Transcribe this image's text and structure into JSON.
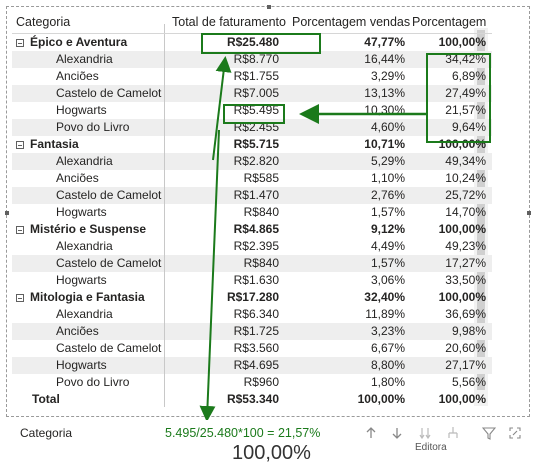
{
  "header": {
    "categoria": "Categoria",
    "faturamento": "Total de faturamento",
    "porc_vendas": "Porcentagem vendas",
    "porcentagem": "Porcentagem"
  },
  "rows": [
    {
      "type": "group",
      "name": "Épico e Aventura",
      "fat": "R$25.480",
      "pv": "47,77%",
      "p": "100,00%"
    },
    {
      "type": "child",
      "name": "Alexandria",
      "fat": "R$8.770",
      "pv": "16,44%",
      "p": "34,42%"
    },
    {
      "type": "child",
      "name": "Anciões",
      "fat": "R$1.755",
      "pv": "3,29%",
      "p": "6,89%"
    },
    {
      "type": "child",
      "name": "Castelo de Camelot",
      "fat": "R$7.005",
      "pv": "13,13%",
      "p": "27,49%"
    },
    {
      "type": "child",
      "name": "Hogwarts",
      "fat": "R$5.495",
      "pv": "10,30%",
      "p": "21,57%"
    },
    {
      "type": "child",
      "name": "Povo do Livro",
      "fat": "R$2.455",
      "pv": "4,60%",
      "p": "9,64%"
    },
    {
      "type": "group",
      "name": "Fantasia",
      "fat": "R$5.715",
      "pv": "10,71%",
      "p": "100,00%"
    },
    {
      "type": "child",
      "name": "Alexandria",
      "fat": "R$2.820",
      "pv": "5,29%",
      "p": "49,34%"
    },
    {
      "type": "child",
      "name": "Anciões",
      "fat": "R$585",
      "pv": "1,10%",
      "p": "10,24%"
    },
    {
      "type": "child",
      "name": "Castelo de Camelot",
      "fat": "R$1.470",
      "pv": "2,76%",
      "p": "25,72%"
    },
    {
      "type": "child",
      "name": "Hogwarts",
      "fat": "R$840",
      "pv": "1,57%",
      "p": "14,70%"
    },
    {
      "type": "group",
      "name": "Mistério e Suspense",
      "fat": "R$4.865",
      "pv": "9,12%",
      "p": "100,00%"
    },
    {
      "type": "child",
      "name": "Alexandria",
      "fat": "R$2.395",
      "pv": "4,49%",
      "p": "49,23%"
    },
    {
      "type": "child",
      "name": "Castelo de Camelot",
      "fat": "R$840",
      "pv": "1,57%",
      "p": "17,27%"
    },
    {
      "type": "child",
      "name": "Hogwarts",
      "fat": "R$1.630",
      "pv": "3,06%",
      "p": "33,50%"
    },
    {
      "type": "group",
      "name": "Mitologia e Fantasia",
      "fat": "R$17.280",
      "pv": "32,40%",
      "p": "100,00%"
    },
    {
      "type": "child",
      "name": "Alexandria",
      "fat": "R$6.340",
      "pv": "11,89%",
      "p": "36,69%"
    },
    {
      "type": "child",
      "name": "Anciões",
      "fat": "R$1.725",
      "pv": "3,23%",
      "p": "9,98%"
    },
    {
      "type": "child",
      "name": "Castelo de Camelot",
      "fat": "R$3.560",
      "pv": "6,67%",
      "p": "20,60%"
    },
    {
      "type": "child",
      "name": "Hogwarts",
      "fat": "R$4.695",
      "pv": "8,80%",
      "p": "27,17%"
    },
    {
      "type": "child",
      "name": "Povo do Livro",
      "fat": "R$960",
      "pv": "1,80%",
      "p": "5,56%"
    },
    {
      "type": "total",
      "name": "Total",
      "fat": "R$53.340",
      "pv": "100,00%",
      "p": "100,00%"
    }
  ],
  "footer": {
    "label": "Categoria",
    "formula": "5.495/25.480*100 = 21,57%",
    "sub_label": "Editora",
    "big_value": "100,00%",
    "icons": [
      "arrow-up-icon",
      "arrow-down-icon",
      "double-arrow-down-icon",
      "expand-hierarchy-icon",
      "filter-icon",
      "focus-mode-icon"
    ]
  },
  "colors": {
    "annotation": "#1b7a1b",
    "row_alt": "#eeeeee",
    "text": "#252423"
  }
}
